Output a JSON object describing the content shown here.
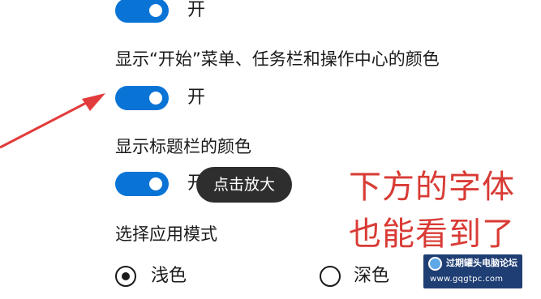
{
  "settings": {
    "top_toggle": {
      "state": "开",
      "on": true
    },
    "start_color": {
      "label": "显示“开始”菜单、任务栏和操作中心的颜色",
      "state": "开",
      "on": true
    },
    "titlebar_color": {
      "label": "显示标题栏的颜色",
      "state": "开",
      "on": true
    },
    "app_mode": {
      "label": "选择应用模式",
      "options": [
        {
          "label": "浅色",
          "selected": true
        },
        {
          "label": "深色",
          "selected": false
        }
      ]
    }
  },
  "tooltip": {
    "text": "点击放大"
  },
  "annotation": {
    "line1": "下方的字体",
    "line2": "也能看到了",
    "color": "#d93b35"
  },
  "watermark": {
    "title": "过期罐头电脑论坛",
    "url": "www.gqgtpc.com"
  },
  "colors": {
    "accent": "#0a74d6",
    "arrow": "#e23b3b"
  }
}
